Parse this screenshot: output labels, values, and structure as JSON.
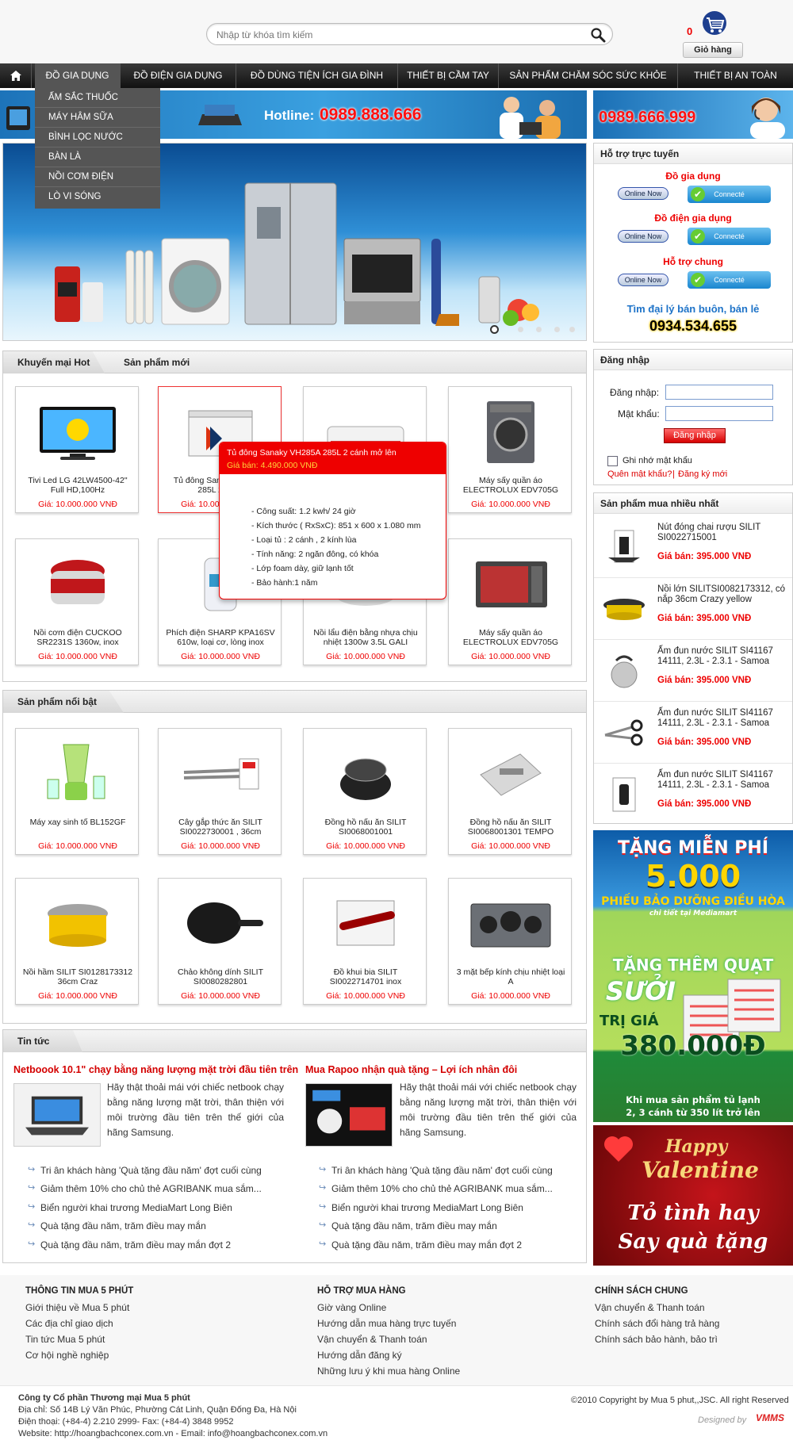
{
  "search": {
    "placeholder": "Nhập từ khóa tìm kiếm"
  },
  "cart": {
    "count": "0",
    "label": "Giỏ hàng"
  },
  "nav": {
    "items": [
      "ĐỒ GIA DỤNG",
      "ĐỒ ĐIỆN GIA DỤNG",
      "ĐỒ DÙNG TIỆN ÍCH GIA ĐÌNH",
      "THIẾT BỊ CẦM TAY",
      "SẢN PHẨM CHĂM SÓC SỨC KHỎE",
      "THIẾT BỊ AN TOÀN"
    ],
    "dropdown": [
      "ẤM SẮC THUỐC",
      "MÁY HÂM SỮA",
      "BÌNH LỌC NƯỚC",
      "BÀN LÀ",
      "NỒI CƠM ĐIỆN",
      "LÒ VI SÓNG"
    ]
  },
  "banner": {
    "hotline_label": "Hotline:",
    "hotline": "0989.888.666",
    "right_hotline": "0989.666.999"
  },
  "support": {
    "title": "Hỗ trợ trực tuyến",
    "groups": [
      "Đồ gia dụng",
      "Đồ điện gia dụng",
      "Hỗ trợ chung"
    ],
    "online_label": "Online Now",
    "connect_label": "Connecté",
    "agent_label": "Tìm đại lý bán buôn, bán lẻ",
    "agent_phone": "0934.534.655"
  },
  "tabs": {
    "hot": "Khuyến mại Hot",
    "new": "Sản phẩm mới"
  },
  "products_hot": [
    {
      "name": "Tivi Led LG 42LW4500-42\" Full HD,100Hz",
      "price": "Giá: 10.000.000 VNĐ"
    },
    {
      "name": "Tủ đông Sanaky VH285A 285L 2 cánh",
      "price": "Giá: 10.000.000 VNĐ"
    },
    {
      "name": "",
      "price": ""
    },
    {
      "name": "Máy sấy quần áo ELECTROLUX EDV705G",
      "price": "Giá: 10.000.000 VNĐ"
    },
    {
      "name": "Nồi cơm điện CUCKOO SR2231S 1360w, inox",
      "price": "Giá: 10.000.000 VNĐ"
    },
    {
      "name": "Phích điện SHARP KPA16SV 610w, loại cơ, lòng inox",
      "price": "Giá: 10.000.000 VNĐ"
    },
    {
      "name": "Nồi lẩu điện bằng nhựa chịu nhiệt 1300w 3.5L GALI",
      "price": "Giá: 10.000.000 VNĐ"
    },
    {
      "name": "Máy sấy quần áo ELECTROLUX EDV705G",
      "price": "Giá: 10.000.000 VNĐ"
    }
  ],
  "tooltip": {
    "title": "Tủ đông Sanaky VH285A 285L 2 cánh mở lên",
    "price": "Giá bán: 4.490.000 VNĐ",
    "lines": [
      "- Công suất: 1.2 kwh/ 24 giờ",
      "- Kích thước ( RxSxC): 851 x 600 x 1.080 mm",
      "- Loại tủ   : 2 cánh , 2 kính lùa",
      "- Tính năng: 2 ngăn đông, có khóa",
      "- Lớp foam dày, giữ lạnh tốt",
      "- Bảo hành:1 năm"
    ]
  },
  "featured": {
    "title": "Sản phẩm nổi bật",
    "items": [
      {
        "name": "Máy xay sinh tố BL152GF",
        "price": "Giá: 10.000.000 VNĐ"
      },
      {
        "name": "Cây gắp thức ăn SILIT SI0022730001 , 36cm",
        "price": "Giá: 10.000.000 VNĐ"
      },
      {
        "name": "Đồng hồ nấu ăn SILIT SI0068001001",
        "price": "Giá: 10.000.000 VNĐ"
      },
      {
        "name": "Đồng hồ nấu ăn SILIT SI0068001301 TEMPO",
        "price": "Giá: 10.000.000 VNĐ"
      },
      {
        "name": "Nồi hầm SILIT SI0128173312 36cm Craz",
        "price": "Giá: 10.000.000 VNĐ"
      },
      {
        "name": "Chảo không dính SILIT SI0080282801",
        "price": "Giá: 10.000.000 VNĐ"
      },
      {
        "name": "Đồ khui bia SILIT SI0022714701 inox",
        "price": "Giá: 10.000.000 VNĐ"
      },
      {
        "name": "3 mặt bếp kính chịu nhiệt loại A",
        "price": "Giá: 10.000.000 VNĐ"
      }
    ]
  },
  "login": {
    "title": "Đăng nhập",
    "user_label": "Đăng nhập:",
    "pass_label": "Mật khẩu:",
    "button": "Đăng nhập",
    "remember": "Ghi nhớ mật khẩu",
    "forgot": "Quên mật khẩu?",
    "sep": "|",
    "register": "Đăng ký mới"
  },
  "bestsellers": {
    "title": "Sản phẩm mua nhiều nhất",
    "items": [
      {
        "name": "Nút đóng chai rượu SILIT SI0022715001",
        "price": "Giá bán: 395.000 VNĐ"
      },
      {
        "name": "Nồi lớn SILITSI0082173312, có nắp 36cm Crazy yellow",
        "price": "Giá bán: 395.000 VNĐ"
      },
      {
        "name": "Ấm đun nước SILIT SI41167 14111, 2.3L - 2.3.1 - Samoa",
        "price": "Giá bán: 395.000 VNĐ"
      },
      {
        "name": "Ấm đun nước SILIT SI41167 14111, 2.3L - 2.3.1 - Samoa",
        "price": "Giá bán: 395.000 VNĐ"
      },
      {
        "name": "Ấm đun nước SILIT SI41167 14111, 2.3L - 2.3.1 - Samoa",
        "price": "Giá bán: 395.000 VNĐ"
      }
    ]
  },
  "ads": {
    "ad1_line1": "TẶNG MIỄN PHÍ",
    "ad1_line2": "5.000",
    "ad1_line3": "PHIẾU BẢO DƯỠNG ĐIỀU HÒA",
    "ad1_line4": "chi tiết tại Mediamart",
    "ad1_line5": "TẶNG THÊM QUẠT",
    "ad1_line6": "SƯỞI",
    "ad1_line7": "TRỊ GIÁ",
    "ad1_line8": "380.000Đ",
    "ad1_line9": "Khi mua sản phẩm tủ lạnh",
    "ad1_line10": "2, 3 cánh từ 350 lít trở lên",
    "ad2_line1": "Happy",
    "ad2_line2": "Valentine",
    "ad2_line3": "Tỏ tình hay",
    "ad2_line4": "Say quà tặng"
  },
  "news": {
    "title": "Tin tức",
    "left": {
      "headline": "Netboook 10.1\" chạy bằng năng lượng mặt trời đầu tiên trên",
      "text": "Hãy thật thoải mái với chiếc netbook chạy bằng năng lượng mặt trời, thân thiện với môi trường đầu tiên trên thế giới của hãng Samsung."
    },
    "right": {
      "headline": "Mua Rapoo nhận quà tặng – Lợi ích nhân đôi",
      "text": "Hãy thật thoải mái với chiếc netbook chạy bằng năng lượng mặt trời, thân thiện với môi trường đầu tiên trên thế giới của hãng Samsung."
    },
    "left_links": [
      "Tri ân khách hàng 'Quà tặng đầu năm' đợt cuối cùng",
      "Giảm thêm 10% cho chủ thẻ AGRIBANK mua sắm...",
      "Biển người khai trương MediaMart Long Biên",
      "Quà tặng đầu năm, trăm điều may mắn",
      "Quà tặng đầu năm, trăm điều may mắn đợt 2"
    ],
    "right_links": [
      "Tri ân khách hàng 'Quà tặng đầu năm' đợt cuối cùng",
      "Giảm thêm 10% cho chủ thẻ AGRIBANK mua sắm...",
      "Biển người khai trương MediaMart Long Biên",
      "Quà tặng đầu năm, trăm điều may mắn",
      "Quà tặng đầu năm, trăm điều may mắn đợt 2"
    ]
  },
  "footer": {
    "col1": {
      "title": "THÔNG TIN MUA 5 PHÚT",
      "links": [
        "Giới thiệu về Mua 5 phút",
        "Các địa chỉ giao dịch",
        "Tin tức Mua 5 phút",
        "Cơ hội nghề nghiệp"
      ]
    },
    "col2": {
      "title": "HỖ TRỢ MUA HÀNG",
      "links": [
        "Giờ vàng Online",
        "Hướng dẫn mua hàng trực tuyến",
        "Vận chuyển & Thanh toán",
        "Hướng dẫn đăng ký",
        "Những lưu ý khi mua hàng Online"
      ]
    },
    "col3": {
      "title": "CHÍNH SÁCH CHUNG",
      "links": [
        "Vận chuyển & Thanh toán",
        "Chính sách đổi hàng trả hàng",
        "Chính sách bảo hành, bảo trì"
      ]
    },
    "company": "Công ty Cổ phần Thương mại Mua 5 phút",
    "address": "Địa chỉ: Số 14B Lý Văn Phúc, Phường Cát Linh, Quận Đống Đa, Hà Nội",
    "phone": "Điện thoại: (+84-4) 2.210 2999- Fax: (+84-4) 3848 9952",
    "website": "Website: http://hoangbachconex.com.vn - Email: info@hoangbachconex.com.vn",
    "copyright": "©2010 Copyright by Mua 5 phut,,JSC. All right Reserved",
    "designed": "Designed by",
    "designer_logo": "VMMS"
  }
}
